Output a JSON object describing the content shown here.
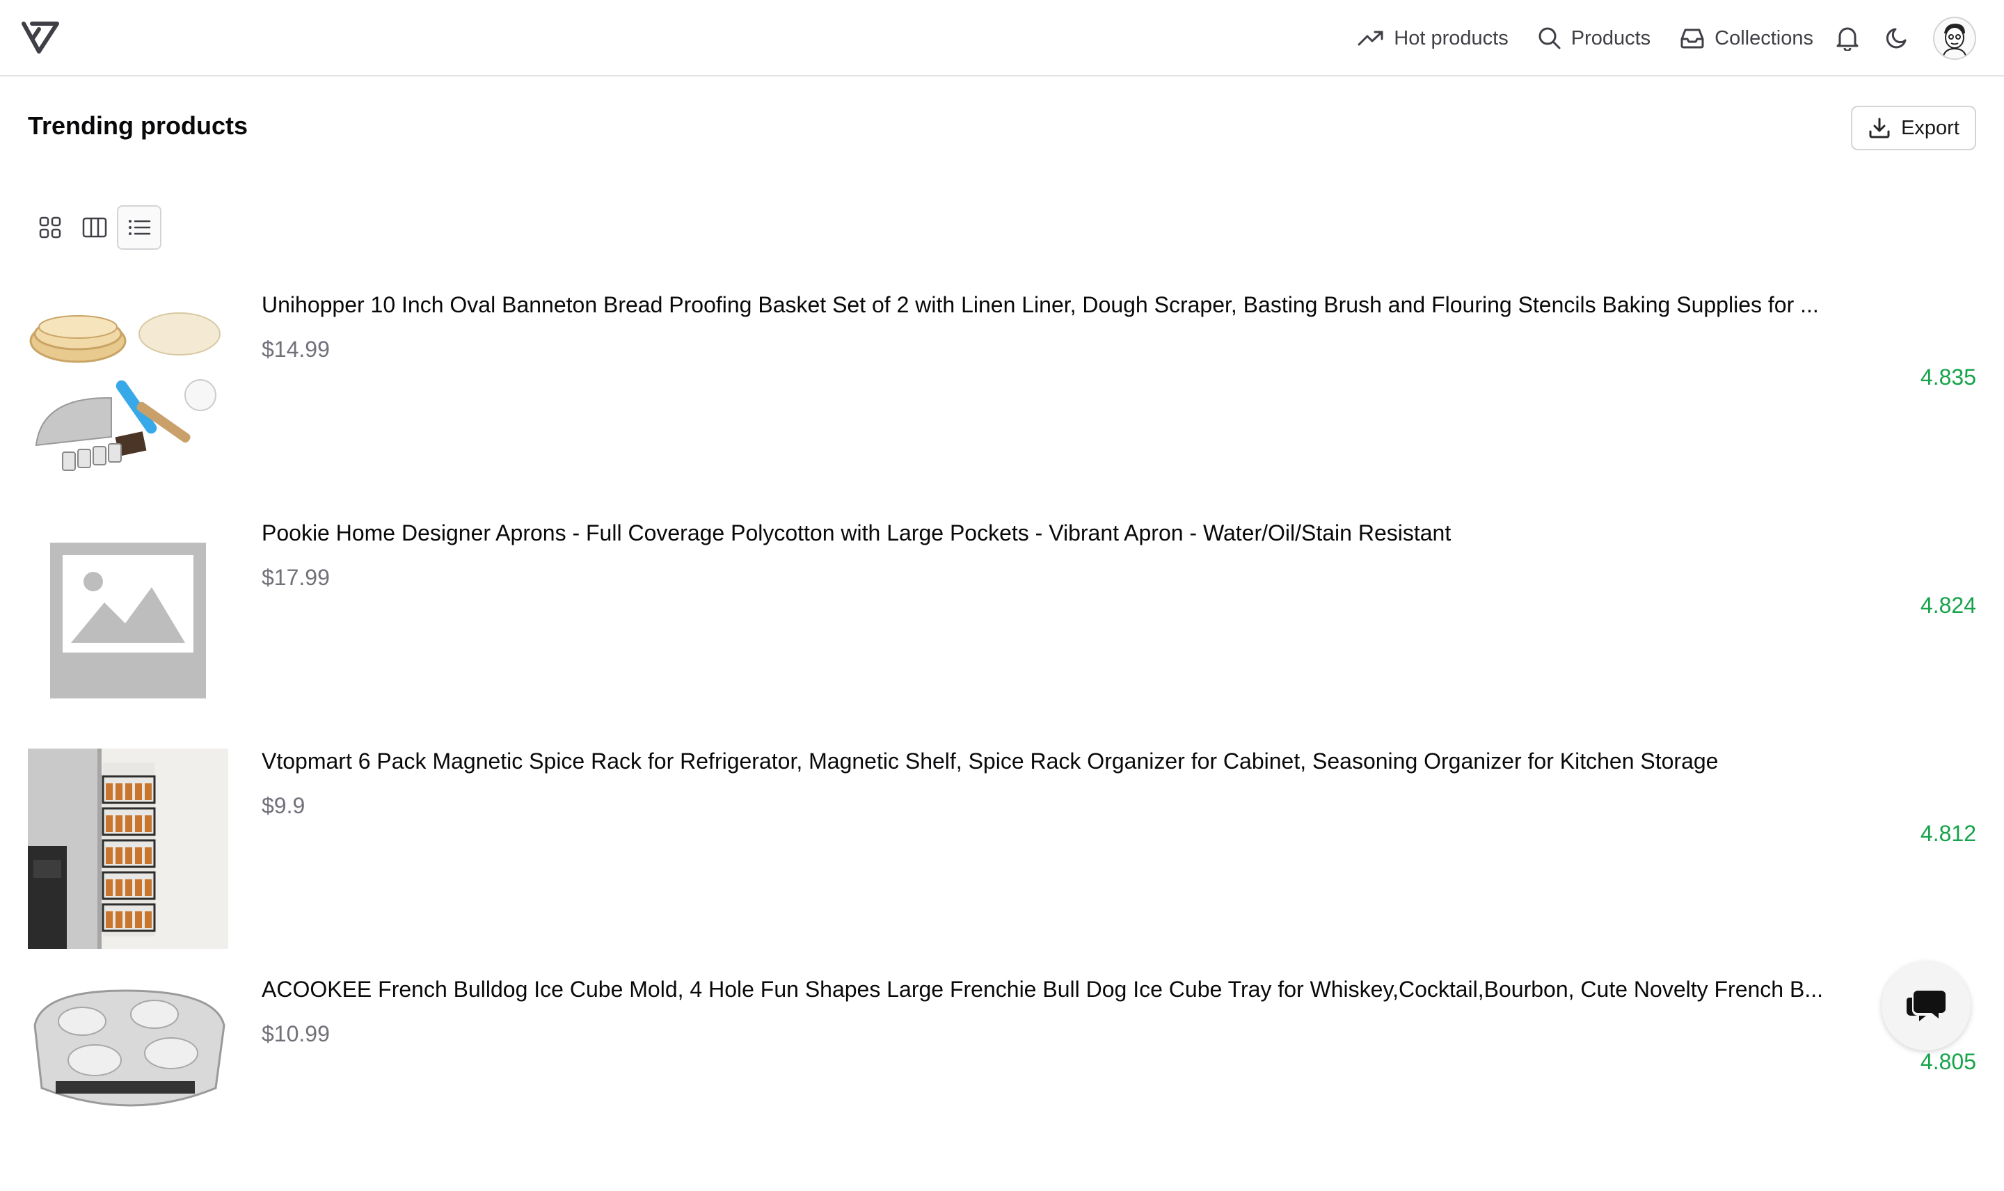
{
  "header": {
    "logo_name": "brand-logo",
    "nav": [
      {
        "label": "Hot products",
        "icon": "trending-up-icon"
      },
      {
        "label": "Products",
        "icon": "search-icon"
      },
      {
        "label": "Collections",
        "icon": "inbox-icon"
      }
    ],
    "icons": [
      "bell-icon",
      "moon-icon"
    ],
    "avatar": "user-avatar"
  },
  "page": {
    "title": "Trending products",
    "export_label": "Export"
  },
  "views": {
    "options": [
      "grid-view",
      "columns-view",
      "list-view"
    ],
    "active": "list-view"
  },
  "products": [
    {
      "title": "Unihopper 10 Inch Oval Banneton Bread Proofing Basket Set of 2 with Linen Liner, Dough Scraper, Basting Brush and Flouring Stencils Baking Supplies for ...",
      "price": "$14.99",
      "rating": "4.835",
      "image": "bread-basket-set"
    },
    {
      "title": "Pookie Home Designer Aprons - Full Coverage Polycotton with Large Pockets - Vibrant Apron - Water/Oil/Stain Resistant",
      "price": "$17.99",
      "rating": "4.824",
      "image": "image-placeholder"
    },
    {
      "title": "Vtopmart 6 Pack Magnetic Spice Rack for Refrigerator, Magnetic Shelf, Spice Rack Organizer for Cabinet, Seasoning Organizer for Kitchen Storage",
      "price": "$9.9",
      "rating": "4.812",
      "image": "spice-rack"
    },
    {
      "title": "ACOOKEE French Bulldog Ice Cube Mold, 4 Hole Fun Shapes Large Frenchie Bull Dog Ice Cube Tray for Whiskey,Cocktail,Bourbon, Cute Novelty French B...",
      "price": "$10.99",
      "rating": "4.805",
      "image": "ice-cube-tray"
    }
  ],
  "colors": {
    "rating": "#16a34a",
    "price": "#71717a",
    "border": "#e4e4e7"
  },
  "chat": {
    "icon": "chat-bubble-icon"
  }
}
